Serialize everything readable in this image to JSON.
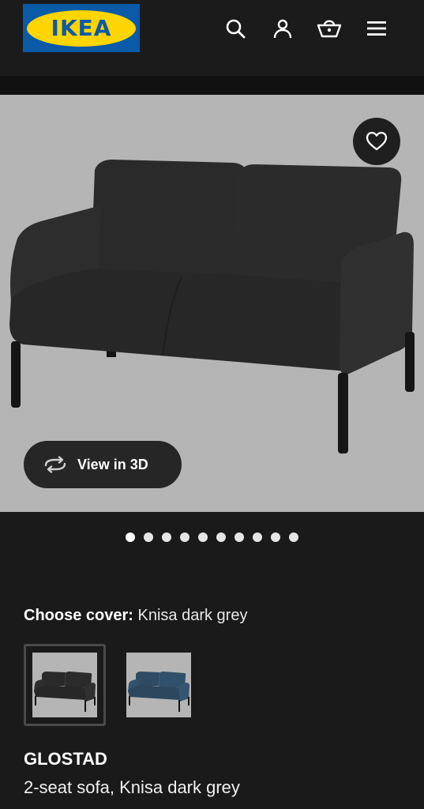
{
  "header": {
    "logo_text": "IKEA",
    "icons": [
      "search-icon",
      "account-icon",
      "basket-icon",
      "menu-icon"
    ]
  },
  "product_image": {
    "view_3d_label": "View in 3D",
    "carousel": {
      "count": 10,
      "active_index": 0
    }
  },
  "cover": {
    "label": "Choose cover:",
    "value": "Knisa dark grey",
    "options": [
      {
        "color": "#2a2a2a",
        "selected": true
      },
      {
        "color": "#2f4a63",
        "selected": false
      }
    ]
  },
  "product": {
    "name": "GLOSTAD",
    "description": "2-seat sofa, Knisa dark grey"
  },
  "colors": {
    "background": "#1a1a1a",
    "image_background": "#b5b5b5",
    "logo_blue": "#0a5aa8",
    "logo_yellow": "#ffd500"
  }
}
